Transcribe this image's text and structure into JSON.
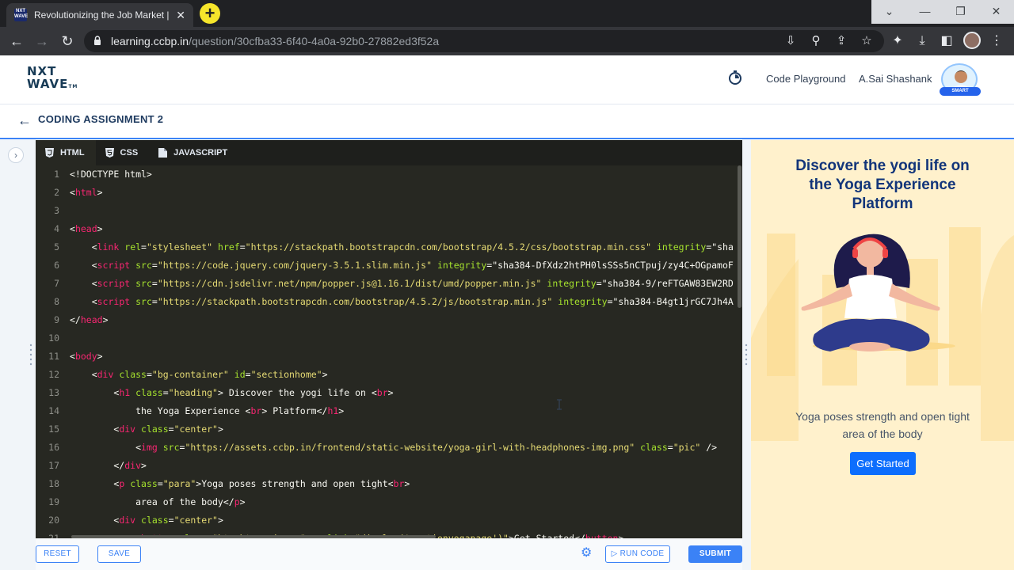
{
  "browser": {
    "tab_title": "Revolutionizing the Job Market | NxtWave",
    "tab_favicon_text": "NXT WAVE",
    "url_host": "learning.ccbp.in",
    "url_path": "/question/30cfba33-6f40-4a0a-92b0-27882ed3f52a"
  },
  "header": {
    "logo_line1": "NXT",
    "logo_line2": "WAVE",
    "logo_tm": "TM",
    "code_playground_link": "Code Playground",
    "user_name": "A.Sai Shashank",
    "avatar_badge": "SMART"
  },
  "assignment": {
    "title": "CODING ASSIGNMENT 2"
  },
  "editor": {
    "tabs": [
      {
        "label": "HTML",
        "active": true
      },
      {
        "label": "CSS",
        "active": false
      },
      {
        "label": "JAVASCRIPT",
        "active": false
      }
    ],
    "code_lines": [
      "<!DOCTYPE html>",
      "<html>",
      "",
      "<head>",
      "    <link rel=\"stylesheet\" href=\"https://stackpath.bootstrapcdn.com/bootstrap/4.5.2/css/bootstrap.min.css\" integrity=\"sha",
      "    <script src=\"https://code.jquery.com/jquery-3.5.1.slim.min.js\" integrity=\"sha384-DfXdz2htPH0lsSSs5nCTpuj/zy4C+OGpamoF",
      "    <script src=\"https://cdn.jsdelivr.net/npm/popper.js@1.16.1/dist/umd/popper.min.js\" integrity=\"sha384-9/reFTGAW83EW2RD",
      "    <script src=\"https://stackpath.bootstrapcdn.com/bootstrap/4.5.2/js/bootstrap.min.js\" integrity=\"sha384-B4gt1jrGC7Jh4A",
      "</head>",
      "",
      "<body>",
      "    <div class=\"bg-container\" id=\"sectionhome\">",
      "        <h1 class=\"heading\"> Discover the yogi life on <br>",
      "            the Yoga Experience <br> Platform</h1>",
      "        <div class=\"center\">",
      "            <img src=\"https://assets.ccbp.in/frontend/static-website/yoga-girl-with-headphones-img.png\" class=\"pic\" />",
      "        </div>",
      "        <p class=\"para\">Yoga poses strength and open tight<br>",
      "            area of the body</p>",
      "        <div class=\"center\">",
      "            <button class=\"btn btn-primary\" onclick=\"display('sectionyogapage')\">Get Started</button>"
    ],
    "buttons": {
      "reset": "RESET",
      "save": "SAVE",
      "run_code": "RUN CODE",
      "submit": "SUBMIT"
    }
  },
  "preview": {
    "heading_line1": "Discover the yogi life on",
    "heading_line2": "the Yoga Experience",
    "heading_line3": "Platform",
    "para_line1": "Yoga poses strength and open tight",
    "para_line2": "area of the body",
    "button": "Get Started"
  },
  "colors": {
    "accent": "#3b82f6",
    "editor_bg": "#272822",
    "preview_bg": "#fff1cc",
    "preview_heading": "#12357a"
  }
}
